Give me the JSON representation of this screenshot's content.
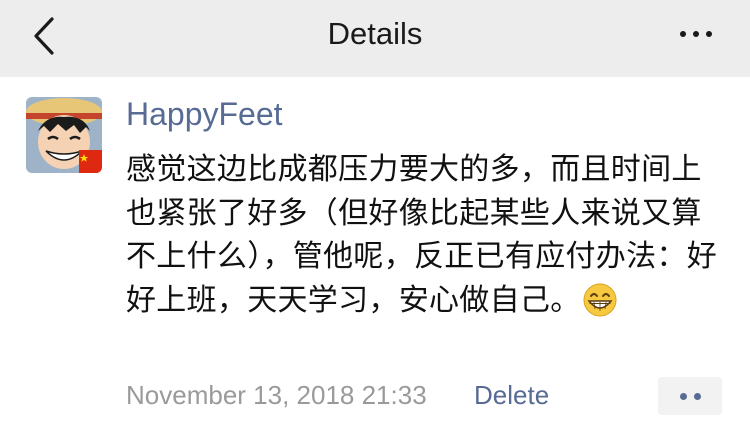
{
  "header": {
    "title": "Details",
    "back_icon": "chevron-left-icon",
    "more_icon": "more-horizontal-icon"
  },
  "post": {
    "username": "HappyFeet",
    "text": "感觉这边比成都压力要大的多，而且时间上也紧张了好多（但好像比起某些人来说又算不上什么），管他呢，反正已有应付办法：好好上班，天天学习，安心做自己。",
    "emoji": "grinning-face-emoji",
    "timestamp": "November 13, 2018 21:33",
    "delete_label": "Delete",
    "action_icon": "two-dots-icon"
  },
  "colors": {
    "link": "#576b95",
    "header_bg": "#ededed",
    "meta": "#9a9a9a"
  }
}
